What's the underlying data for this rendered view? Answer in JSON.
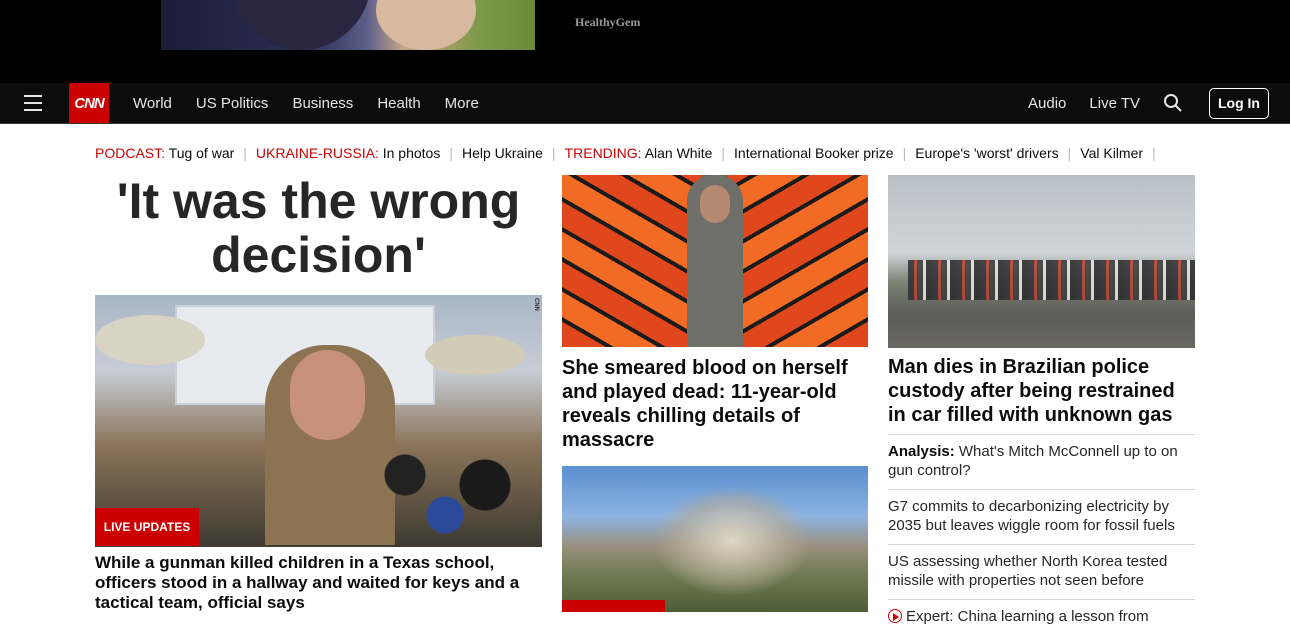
{
  "ad": {
    "brand": "HealthyGem"
  },
  "nav": {
    "logo": "CNN",
    "links": [
      "World",
      "US Politics",
      "Business",
      "Health",
      "More"
    ],
    "right_links": [
      "Audio",
      "Live TV"
    ],
    "login": "Log In"
  },
  "trending": {
    "items": [
      {
        "kicker": "PODCAST:",
        "text": "Tug of war"
      },
      {
        "kicker": "UKRAINE-RUSSIA:",
        "text": "In photos"
      },
      {
        "kicker": "",
        "text": "Help Ukraine"
      },
      {
        "kicker": "TRENDING:",
        "text": "Alan White"
      },
      {
        "kicker": "",
        "text": "International Booker prize"
      },
      {
        "kicker": "",
        "text": "Europe's 'worst' drivers"
      },
      {
        "kicker": "",
        "text": "Val Kilmer"
      }
    ]
  },
  "lead": {
    "headline": "'It was the wrong decision'",
    "image_tag": "CNN",
    "badge": "LIVE UPDATES",
    "caption": "While a gunman killed children in a Texas school, officers stood in a hallway and waited for keys and a tactical team, official says"
  },
  "middle": {
    "story1": "She smeared blood on herself and played dead: 11-year-old reveals chilling details of massacre"
  },
  "right": {
    "headline": "Man dies in Brazilian police custody after being restrained in car filled with unknown gas",
    "list": [
      {
        "bold": "Analysis:",
        "text": " What's Mitch McConnell up to on gun control?"
      },
      {
        "bold": "",
        "text": "G7 commits to decarbonizing electricity by 2035 but leaves wiggle room for fossil fuels"
      },
      {
        "bold": "",
        "text": "US assessing whether North Korea tested missile with properties not seen before"
      },
      {
        "bold": "",
        "text": "Expert: China learning a lesson from"
      }
    ]
  },
  "colors": {
    "brand": "#cc0000",
    "nav_bg": "#0c0c0c"
  }
}
